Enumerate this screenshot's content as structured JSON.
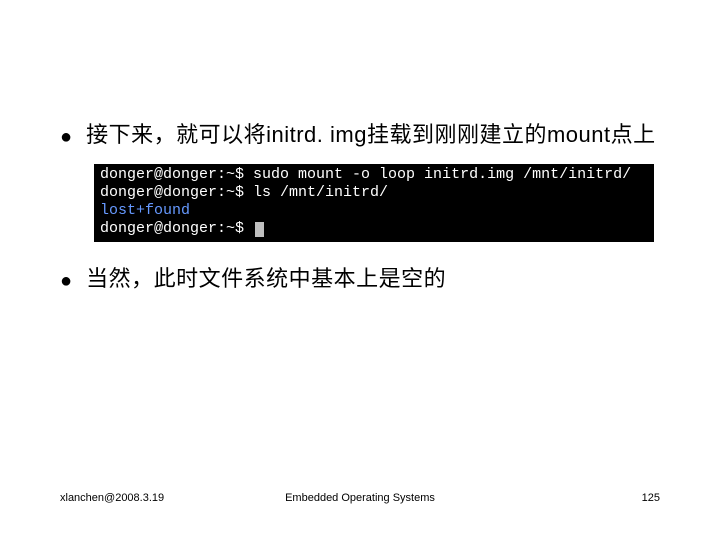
{
  "bullets": [
    "接下来，就可以将initrd. img挂载到刚刚建立的mount点上",
    "当然，此时文件系统中基本上是空的"
  ],
  "terminal": {
    "line1_prompt": "donger@donger:~$ ",
    "line1_cmd": "sudo mount -o loop initrd.img /mnt/initrd/",
    "line2_prompt": "donger@donger:~$ ",
    "line2_cmd": "ls /mnt/initrd/",
    "line3_output": "lost+found",
    "line4_prompt": "donger@donger:~$ "
  },
  "footer": {
    "left": "xlanchen@2008.3.19",
    "center": "Embedded Operating Systems",
    "right": "125"
  }
}
